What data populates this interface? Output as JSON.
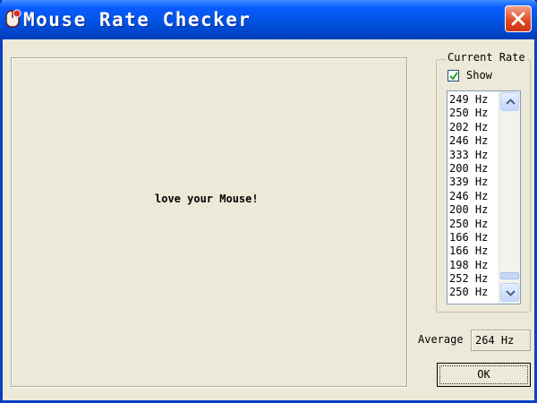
{
  "window": {
    "title": "Mouse Rate Checker"
  },
  "canvas": {
    "message": "love your Mouse!"
  },
  "panel": {
    "group_title": "Current Rate",
    "show_label": "Show",
    "show_checked": true,
    "rates": [
      "249 Hz",
      "250 Hz",
      "202 Hz",
      "246 Hz",
      "333 Hz",
      "200 Hz",
      "339 Hz",
      "246 Hz",
      "200 Hz",
      "250 Hz",
      "166 Hz",
      "166 Hz",
      "198 Hz",
      "252 Hz",
      "250 Hz"
    ]
  },
  "average": {
    "label": "Average",
    "value": "264 Hz"
  },
  "ok_button": {
    "label": "OK"
  },
  "icons": {
    "app": "mouse-app-icon",
    "close": "close-icon",
    "check": "checkmark-icon",
    "scroll_up": "chevron-up-icon",
    "scroll_down": "chevron-down-icon"
  },
  "colors": {
    "titlebar": "#0054e3",
    "close": "#e0461f",
    "face": "#ece9d8"
  }
}
